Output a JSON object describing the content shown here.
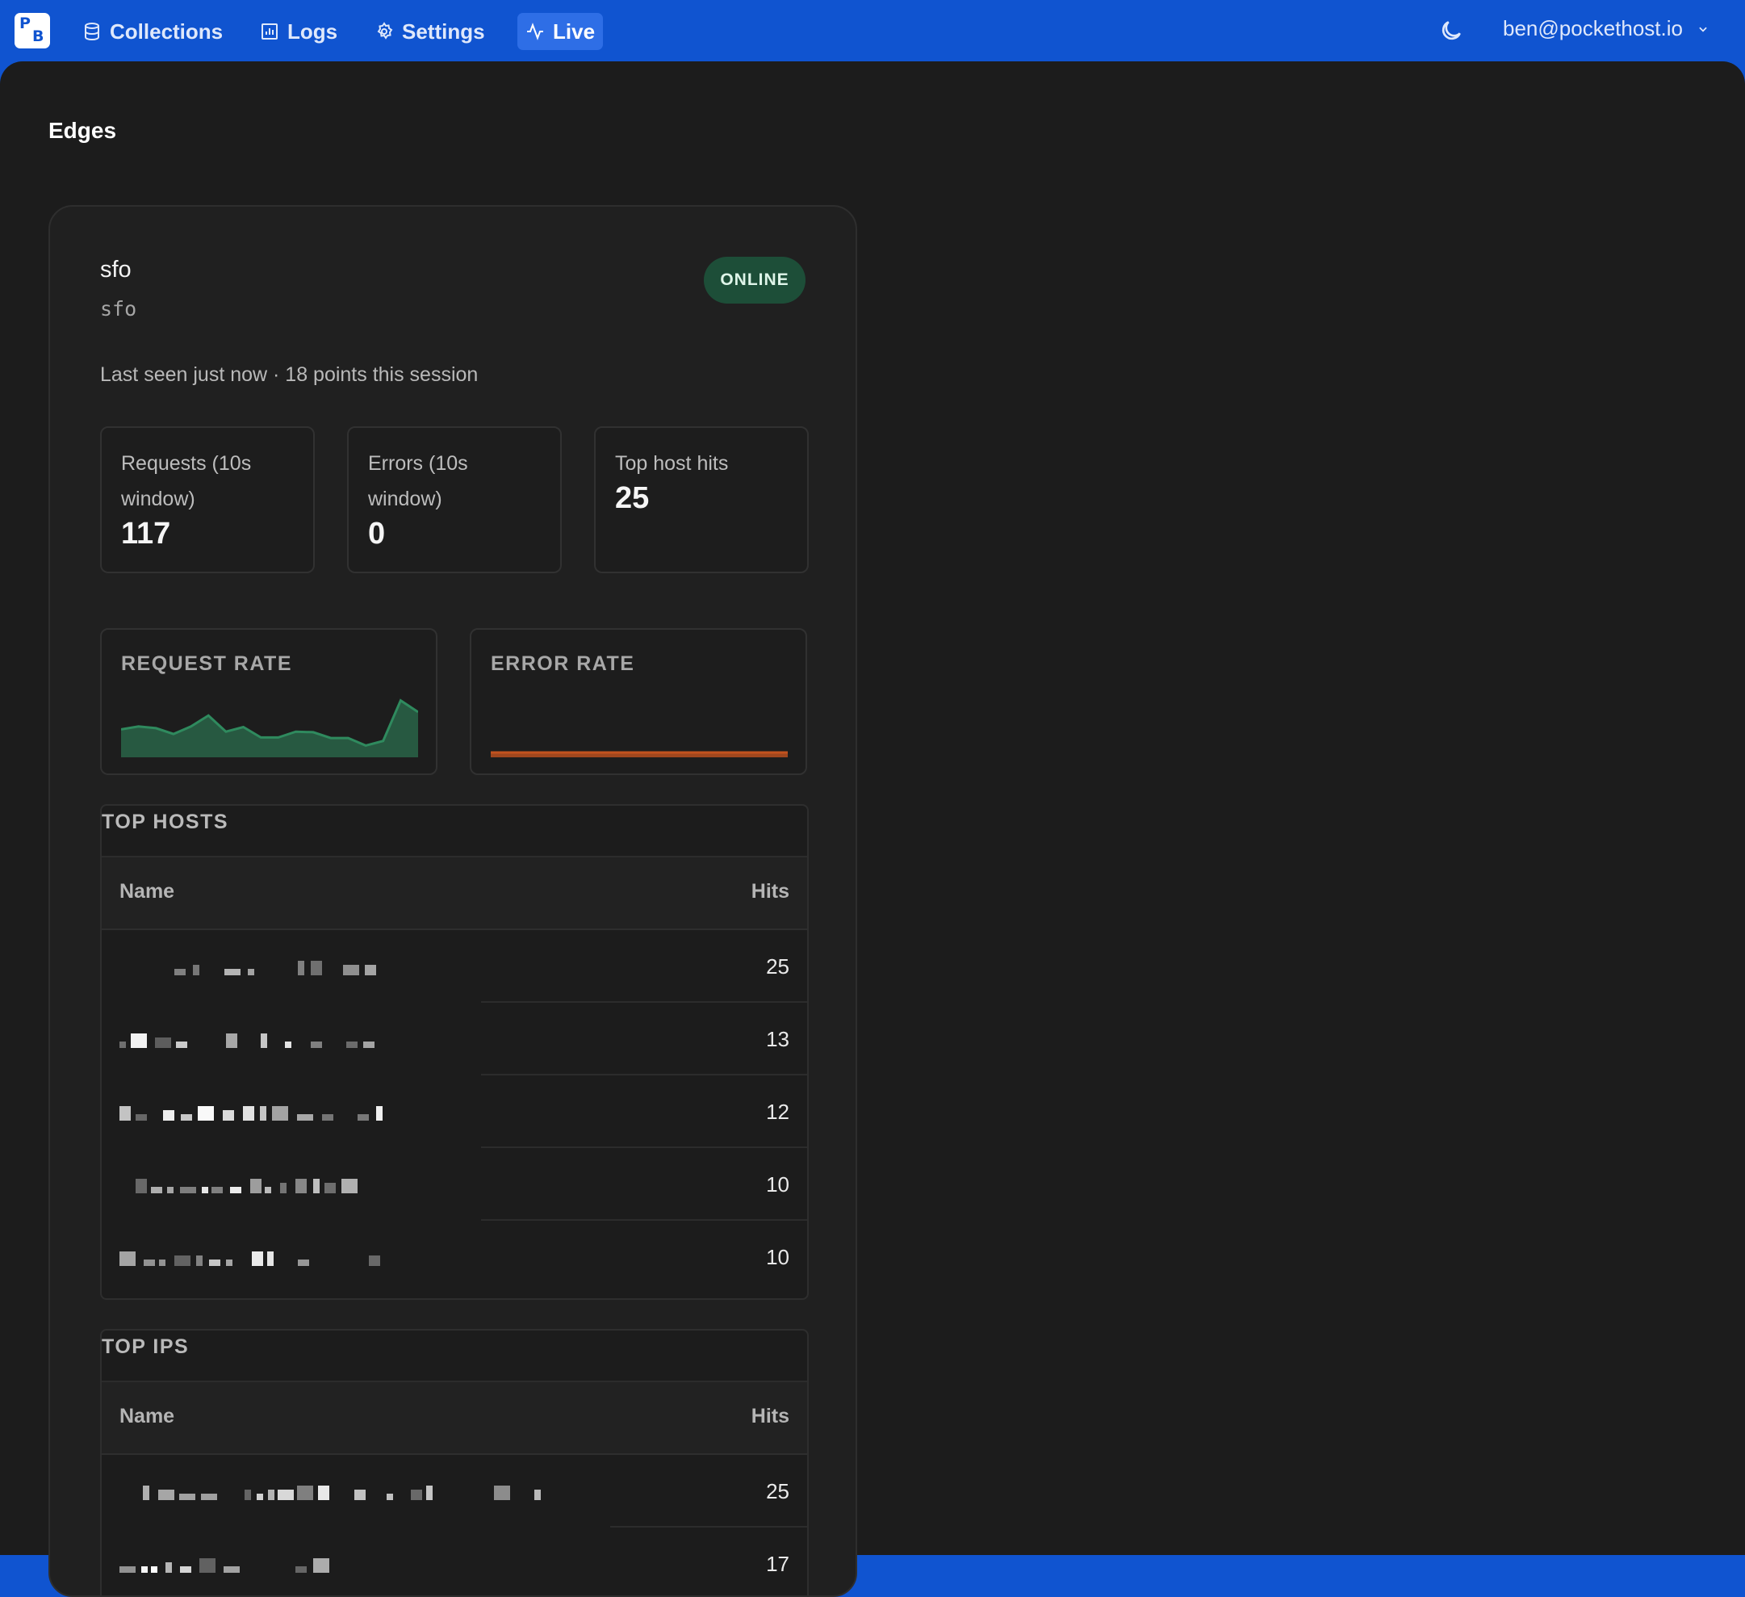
{
  "nav": {
    "logo_letters": [
      "P",
      "B"
    ],
    "items": [
      {
        "label": "Collections",
        "icon": "database-icon"
      },
      {
        "label": "Logs",
        "icon": "chart-bar-icon"
      },
      {
        "label": "Settings",
        "icon": "gear-icon"
      },
      {
        "label": "Live",
        "icon": "pulse-icon"
      }
    ],
    "active": "Live",
    "theme_icon": "moon-icon",
    "user_email": "ben@pockethost.io"
  },
  "page": {
    "title": "Edges"
  },
  "edge": {
    "name": "sfo",
    "code": "sfo",
    "status": "ONLINE",
    "last_seen": "Last seen just now · 18 points this session",
    "stats": [
      {
        "label": "Requests (10s window)",
        "value": "117"
      },
      {
        "label": "Errors (10s window)",
        "value": "0"
      },
      {
        "label": "Top host hits",
        "value": "25"
      }
    ],
    "request_rate": {
      "label": "REQUEST RATE",
      "values": [
        4,
        4.5,
        4.2,
        3.2,
        4.5,
        6.4,
        3.6,
        4.4,
        2.6,
        2.6,
        3.6,
        3.5,
        2.5,
        2.5,
        1.2,
        2.0,
        9.0,
        7.0
      ],
      "color": "#2f8a5e"
    },
    "error_rate": {
      "label": "ERROR RATE",
      "values": [
        0,
        0,
        0,
        0,
        0,
        0,
        0,
        0,
        0,
        0,
        0,
        0,
        0,
        0,
        0,
        0,
        0,
        0
      ],
      "color": "#c2521f"
    },
    "top_hosts": {
      "title": "TOP HOSTS",
      "columns": [
        "Name",
        "Hits"
      ],
      "rows": [
        {
          "name": "",
          "hits": "25"
        },
        {
          "name": "",
          "hits": "13"
        },
        {
          "name": "",
          "hits": "12"
        },
        {
          "name": "",
          "hits": "10"
        },
        {
          "name": "",
          "hits": "10"
        }
      ]
    },
    "top_ips": {
      "title": "TOP IPS",
      "columns": [
        "Name",
        "Hits"
      ],
      "rows": [
        {
          "name": "",
          "hits": "25"
        },
        {
          "name": "",
          "hits": "17"
        }
      ]
    }
  }
}
